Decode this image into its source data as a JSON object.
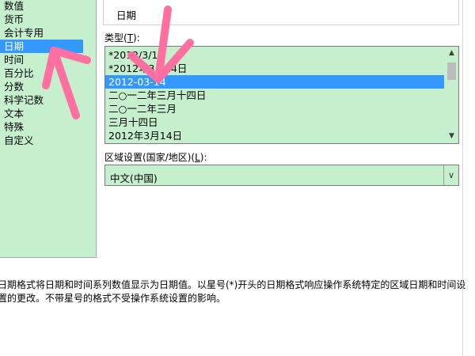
{
  "category_list": {
    "items": [
      "数值",
      "货币",
      "会计专用",
      "日期",
      "时间",
      "百分比",
      "分数",
      "科学记数",
      "文本",
      "特殊",
      "自定义"
    ],
    "selected_index": 3
  },
  "sample": {
    "value": "日期"
  },
  "type_section": {
    "label_prefix": "类型(",
    "label_key": "T",
    "label_suffix": "):",
    "items": [
      "*2012/3/14",
      "*2012年3月14日",
      "2012-03-14",
      "二○一二年三月十四日",
      "二○一二年三月",
      "三月十四日",
      "2012年3月14日"
    ],
    "selected_index": 2
  },
  "region_section": {
    "label_prefix": "区域设置(国家/地区)(",
    "label_key": "L",
    "label_suffix": "):",
    "value": "中文(中国)"
  },
  "description": "日期格式将日期和时间系列数值显示为日期值。以星号(*)开头的日期格式响应操作系统特定的区域日期和时间设置的更改。不带星号的格式不受操作系统设置的影响。",
  "colors": {
    "list_background": "#c6efce",
    "selection": "#3399ff",
    "annotation_arrow": "#ff6f9f"
  },
  "icons": {
    "scroll_up": "▲",
    "scroll_down": "▼",
    "dropdown": "∨"
  }
}
